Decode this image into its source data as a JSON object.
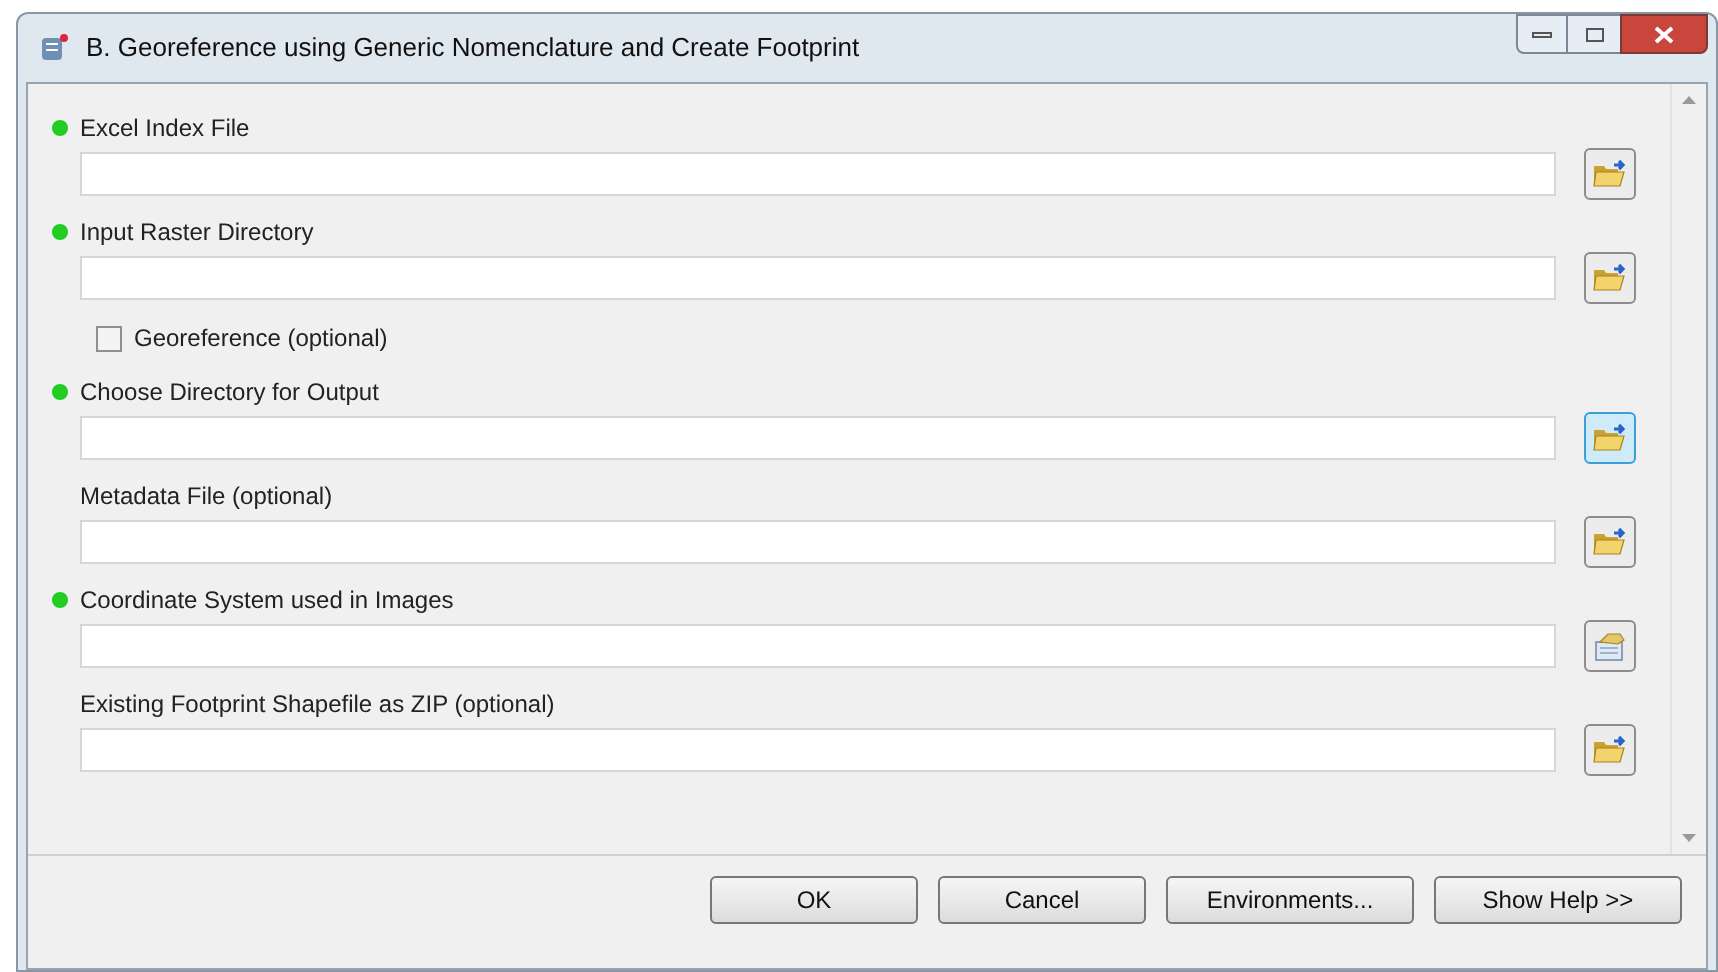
{
  "window": {
    "title": "B. Georeference using Generic Nomenclature and Create Footprint"
  },
  "parameters": [
    {
      "kind": "field",
      "label": "Excel Index File",
      "required": true,
      "browse": {
        "kind": "folder",
        "highlighted": false
      }
    },
    {
      "kind": "field",
      "label": "Input Raster Directory",
      "required": true,
      "browse": {
        "kind": "folder",
        "highlighted": false
      }
    },
    {
      "kind": "checkbox",
      "label": "Georeference (optional)",
      "checked": false
    },
    {
      "kind": "field",
      "label": "Choose Directory for Output",
      "required": true,
      "browse": {
        "kind": "folder",
        "highlighted": true
      }
    },
    {
      "kind": "field",
      "label": "Metadata File (optional)",
      "required": false,
      "browse": {
        "kind": "folder",
        "highlighted": false
      }
    },
    {
      "kind": "field",
      "label": "Coordinate System used in Images",
      "required": true,
      "browse": {
        "kind": "properties",
        "highlighted": false
      }
    },
    {
      "kind": "field",
      "label": "Existing Footprint Shapefile as ZIP (optional)",
      "required": false,
      "browse": {
        "kind": "folder",
        "highlighted": false
      }
    }
  ],
  "buttons": [
    "OK",
    "Cancel",
    "Environments...",
    "Show Help >>"
  ]
}
